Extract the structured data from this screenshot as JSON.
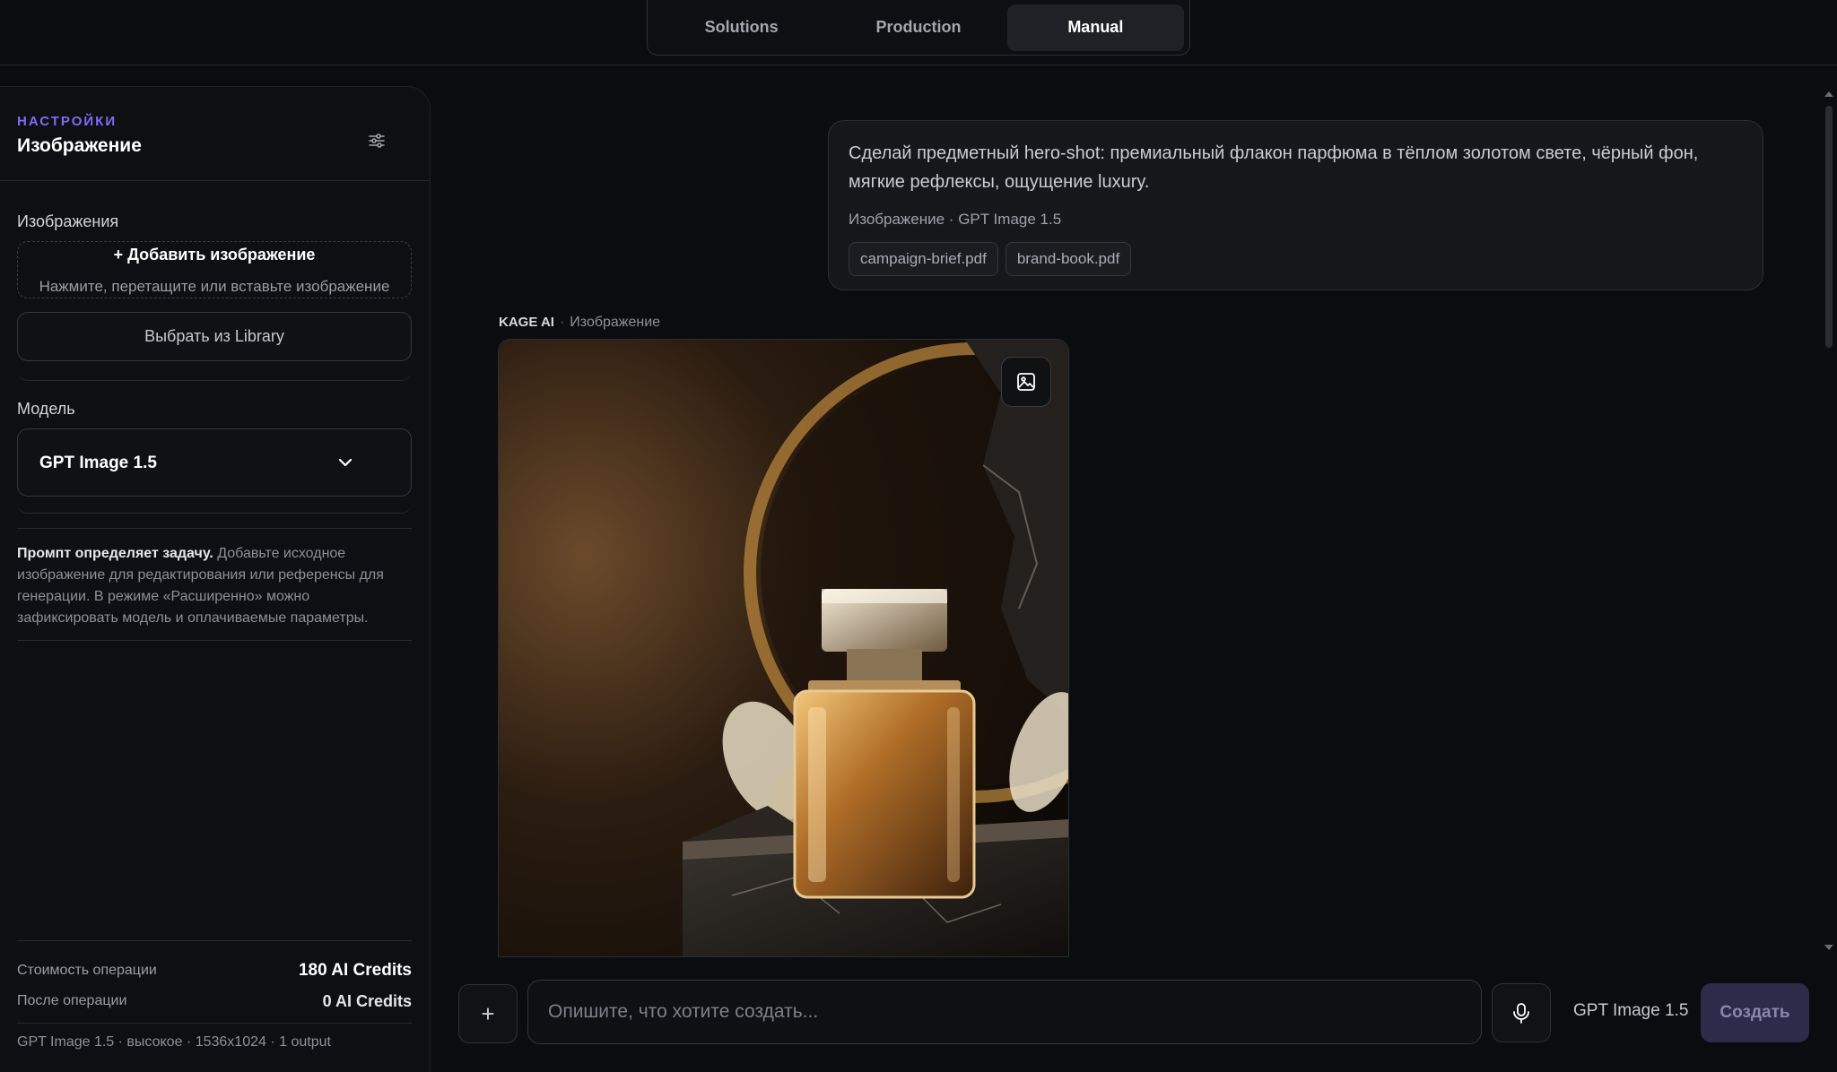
{
  "topbar": {
    "tabs": [
      {
        "label": "Solutions"
      },
      {
        "label": "Production"
      },
      {
        "label": "Manual"
      }
    ],
    "active_tab": "Manual"
  },
  "sidebar": {
    "eyebrow": "НАСТРОЙКИ",
    "title": "Изображение",
    "images_label": "Изображения",
    "upload_title": "+ Добавить изображение",
    "upload_hint": "Нажмите, перетащите или вставьте изображение",
    "library_button": "Выбрать из Library",
    "model_label": "Модель",
    "model_value": "GPT Image 1.5",
    "hint_bold": "Промпт определяет задачу.",
    "hint_text": "Добавьте исходное изображение для редактирования или референсы для генерации. В режиме «Расширенно» можно зафиксировать модель и оплачиваемые параметры.",
    "cost_label": "Стоимость операции",
    "cost_value": "180 AI Credits",
    "after_label": "После операции",
    "after_value": "0 AI Credits",
    "footer_meta": "GPT Image 1.5 · высокое · 1536x1024 · 1 output"
  },
  "chat": {
    "user_message": "Сделай предметный hero-shot: премиальный флакон парфюма в тёплом золотом свете, чёрный фон, мягкие рефлексы, ощущение luxury.",
    "user_meta": "Изображение · GPT Image 1.5",
    "attachments": [
      "campaign-brief.pdf",
      "brand-book.pdf"
    ],
    "ai_brand": "KAGE AI",
    "ai_type": "Изображение"
  },
  "composer": {
    "plus": "+",
    "placeholder": "Опишите, что хотите создать...",
    "model": "GPT Image 1.5",
    "submit": "Создать"
  },
  "colors": {
    "accent": "#7c6cf6",
    "background": "#0b0c0f",
    "panel": "#0e0f12",
    "create_button": "#2d2a4a"
  },
  "icons": {
    "tune": "sliders-icon",
    "chevron": "chevron-down-icon",
    "image": "image-icon",
    "mic": "microphone-icon"
  }
}
